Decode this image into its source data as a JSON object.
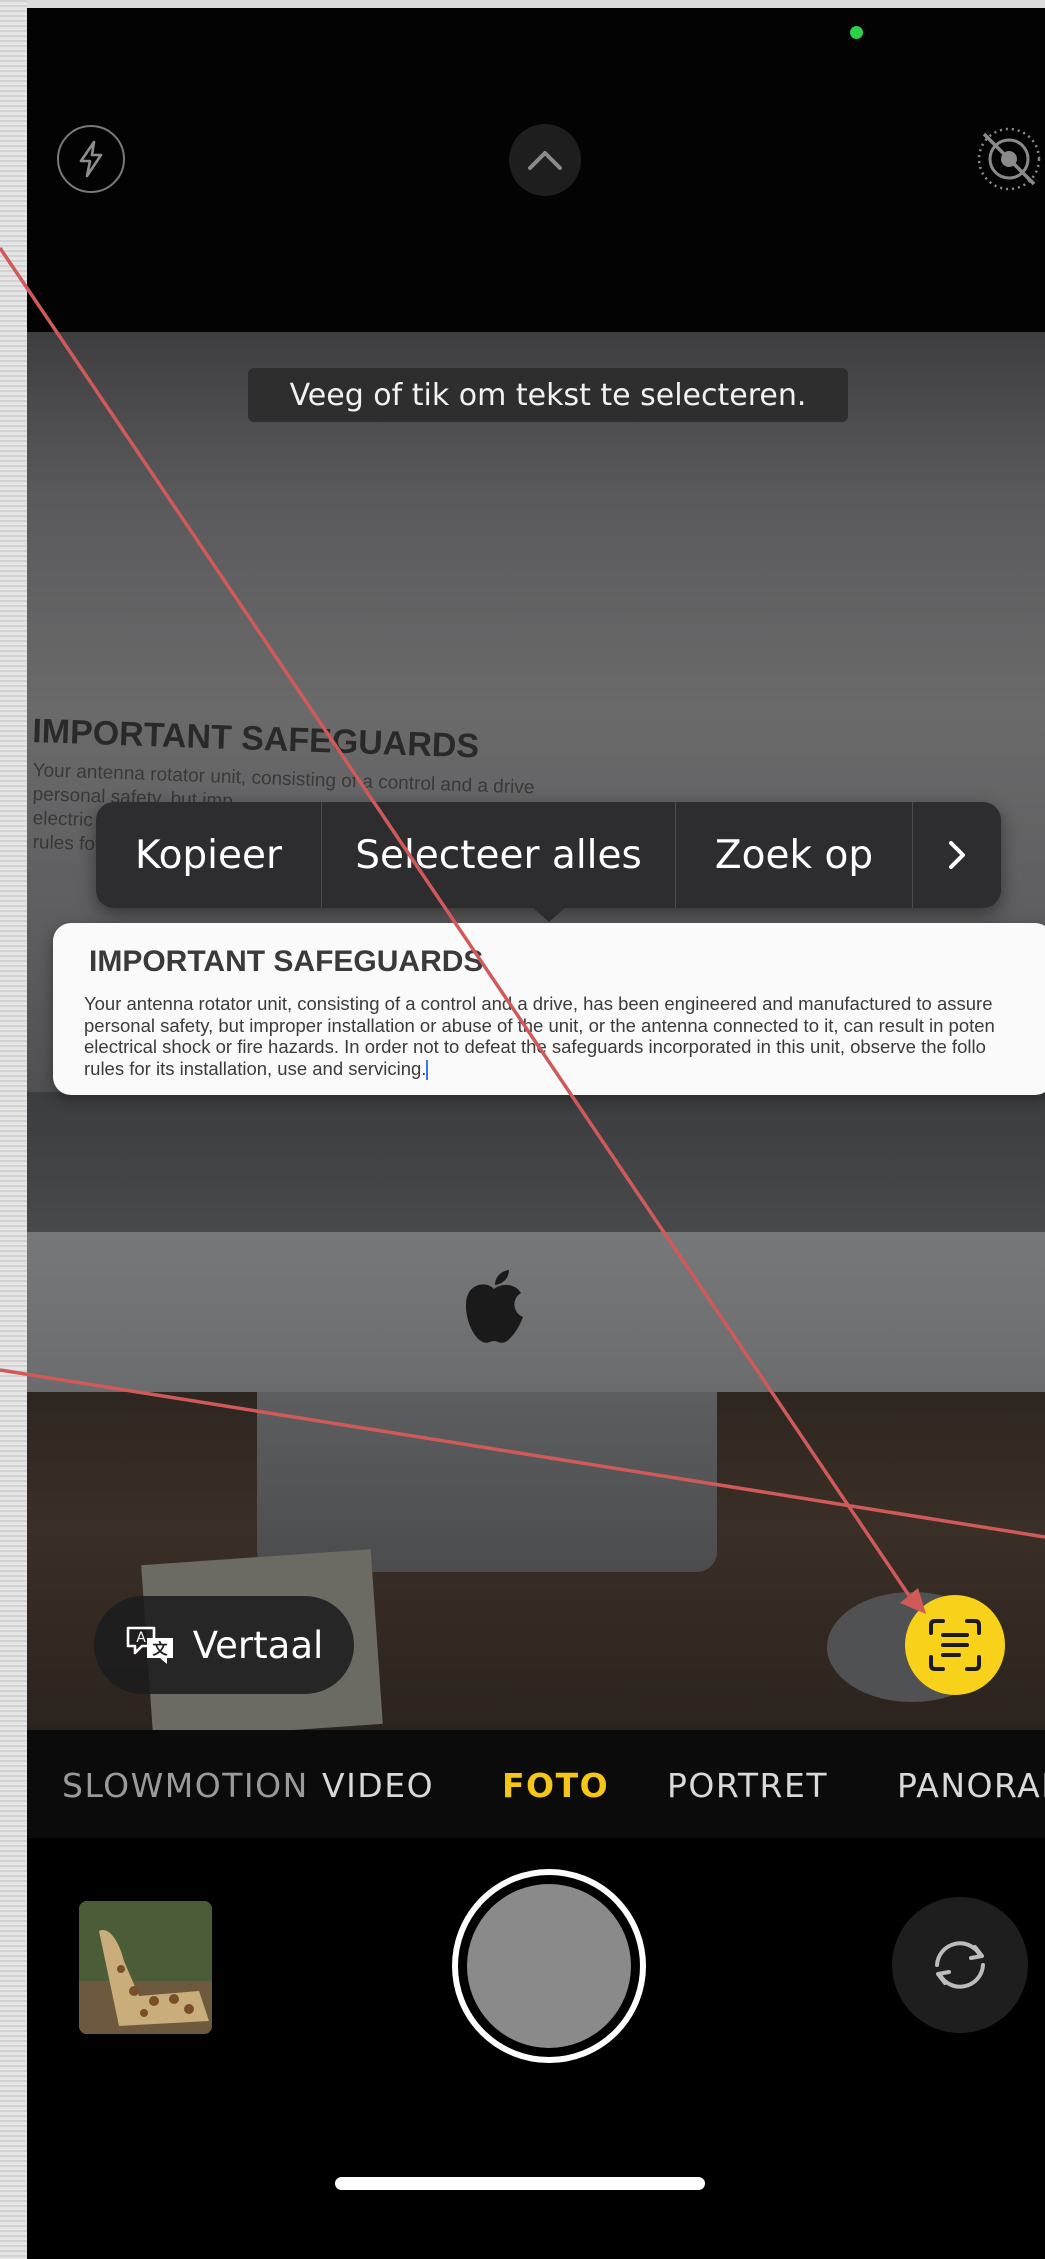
{
  "top_bar": {
    "flash_icon": "bolt-icon",
    "expand_icon": "chevron-up-icon",
    "live_photo_icon": "live-photo-off-icon",
    "status_dot_color": "#2bd14a"
  },
  "viewfinder": {
    "hint": "Veeg of tik om tekst te selecteren.",
    "document_title": "IMPORTANT SAFEGUARDS",
    "document_fragments": [
      "Your antenna rotator unit, consisting of a control and a drive",
      "personal safety, but imp",
      "electric",
      "rules fo"
    ]
  },
  "context_menu": {
    "copy": "Kopieer",
    "select_all": "Selecteer alles",
    "look_up": "Zoek op",
    "more_icon": "chevron-right-icon"
  },
  "text_card": {
    "title": "IMPORTANT SAFEGUARDS",
    "lines": [
      "Your antenna rotator unit, consisting of a control and a drive, has been engineered and manufactured to assure",
      "personal safety, but improper installation or abuse of the unit, or the antenna connected to it, can result in poten",
      "electrical shock or fire hazards. In order not to defeat the safeguards incorporated in this unit, observe the follo",
      "rules for its installation, use and servicing."
    ]
  },
  "translate": {
    "label": "Vertaal",
    "icon": "translate-icon"
  },
  "live_text_button": {
    "icon": "live-text-icon",
    "color": "#f8d11a"
  },
  "modes": {
    "items": [
      "SLOWMOTION",
      "VIDEO",
      "FOTO",
      "PORTRET",
      "PANORAMA"
    ],
    "active": "FOTO",
    "active_color": "#f5c518"
  },
  "controls": {
    "thumbnail": "last-photo-thumbnail",
    "shutter": "shutter-button",
    "flip_icon": "camera-flip-icon"
  }
}
